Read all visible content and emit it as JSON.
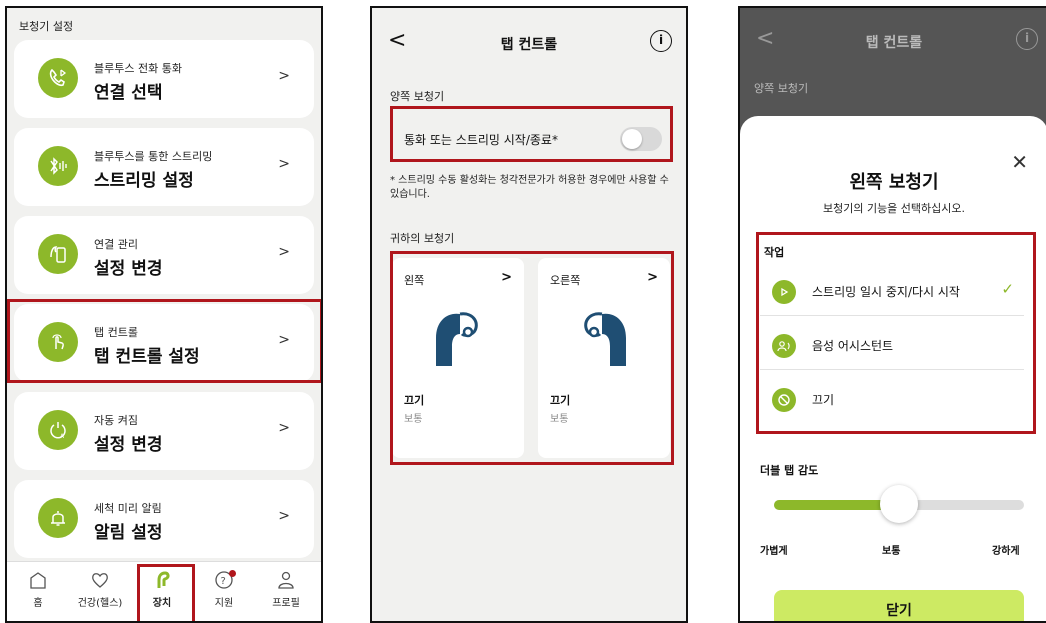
{
  "settings": {
    "header": "보청기 설정",
    "cards": [
      {
        "sub": "블루투스 전화 통화",
        "main": "연결 선택"
      },
      {
        "sub": "블루투스를 통한 스트리밍",
        "main": "스트리밍 설정"
      },
      {
        "sub": "연결 관리",
        "main": "설정 변경"
      },
      {
        "sub": "탭 컨트롤",
        "main": "탭 컨트롤 설정"
      },
      {
        "sub": "자동 켜짐",
        "main": "설정 변경"
      },
      {
        "sub": "세척 미리 알림",
        "main": "알림 설정"
      }
    ],
    "chevron": ">",
    "nav": [
      {
        "label": "홈"
      },
      {
        "label": "건강(헬스)"
      },
      {
        "label": "장치"
      },
      {
        "label": "지원"
      },
      {
        "label": "프로필"
      }
    ]
  },
  "tap_control": {
    "title": "탭 컨트롤",
    "back": "<",
    "info": "i",
    "both_label": "양쪽 보청기",
    "toggle_label": "통화 또는 스트리밍 시작/종료*",
    "note": "* 스트리밍 수동 활성화는 청각전문가가 허용한 경우에만 사용할 수 있습니다.",
    "your_label": "귀하의 보청기",
    "left": {
      "side": "왼쪽",
      "state": "끄기",
      "sensitivity": "보통"
    },
    "right": {
      "side": "오른쪽",
      "state": "끄기",
      "sensitivity": "보통"
    },
    "chevron": ">"
  },
  "sheet": {
    "top_title": "탭 컨트롤",
    "top_section": "양쪽 보청기",
    "back": "<",
    "info": "i",
    "close_icon": "✕",
    "title": "왼쪽 보청기",
    "subtitle": "보청기의 기능을 선택하십시오.",
    "action_label": "작업",
    "options": [
      {
        "label": "스트리밍 일시 중지/다시 시작",
        "selected": true
      },
      {
        "label": "음성 어시스턴트",
        "selected": false
      },
      {
        "label": "끄기",
        "selected": false
      }
    ],
    "check": "✓",
    "double_tap_label": "더블 탭 감도",
    "slider_value": 0.5,
    "slider_labels": {
      "low": "가볍게",
      "mid": "보통",
      "high": "강하게"
    },
    "close_button": "닫기"
  },
  "colors": {
    "accent": "#8db82a",
    "highlight": "#b0161c",
    "button": "#cdea63"
  }
}
